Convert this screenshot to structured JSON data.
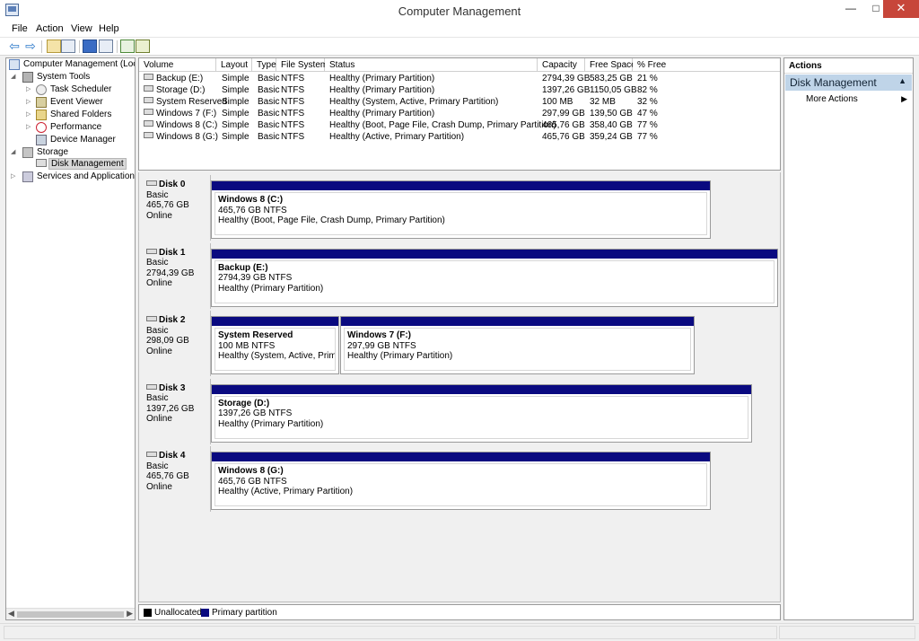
{
  "window": {
    "title": "Computer Management",
    "min": "—",
    "max": "□",
    "close": "✕"
  },
  "menu": [
    "File",
    "Action",
    "View",
    "Help"
  ],
  "toolbar": {
    "back": "⇦",
    "forward": "⇨"
  },
  "tree": {
    "root": "Computer Management (Local",
    "system_tools": "System Tools",
    "task_scheduler": "Task Scheduler",
    "event_viewer": "Event Viewer",
    "shared_folders": "Shared Folders",
    "performance": "Performance",
    "device_manager": "Device Manager",
    "storage": "Storage",
    "disk_management": "Disk Management",
    "services": "Services and Applications"
  },
  "volumes": {
    "headers": [
      "Volume",
      "Layout",
      "Type",
      "File System",
      "Status",
      "Capacity",
      "Free Space",
      "% Free"
    ],
    "rows": [
      [
        "Backup (E:)",
        "Simple",
        "Basic",
        "NTFS",
        "Healthy (Primary Partition)",
        "2794,39 GB",
        "583,25 GB",
        "21 %"
      ],
      [
        "Storage (D:)",
        "Simple",
        "Basic",
        "NTFS",
        "Healthy (Primary Partition)",
        "1397,26 GB",
        "1150,05 GB",
        "82 %"
      ],
      [
        "System Reserved",
        "Simple",
        "Basic",
        "NTFS",
        "Healthy (System, Active, Primary Partition)",
        "100 MB",
        "32 MB",
        "32 %"
      ],
      [
        "Windows 7 (F:)",
        "Simple",
        "Basic",
        "NTFS",
        "Healthy (Primary Partition)",
        "297,99 GB",
        "139,50 GB",
        "47 %"
      ],
      [
        "Windows 8 (C:)",
        "Simple",
        "Basic",
        "NTFS",
        "Healthy (Boot, Page File, Crash Dump, Primary Partition)",
        "465,76 GB",
        "358,40 GB",
        "77 %"
      ],
      [
        "Windows 8 (G:)",
        "Simple",
        "Basic",
        "NTFS",
        "Healthy (Active, Primary Partition)",
        "465,76 GB",
        "359,24 GB",
        "77 %"
      ]
    ]
  },
  "disks": [
    {
      "name": "Disk 0",
      "type": "Basic",
      "size": "465,76 GB",
      "state": "Online",
      "partitions": [
        {
          "name": "Windows 8  (C:)",
          "size": "465,76 GB NTFS",
          "status": "Healthy (Boot, Page File, Crash Dump, Primary Partition)"
        }
      ]
    },
    {
      "name": "Disk 1",
      "type": "Basic",
      "size": "2794,39 GB",
      "state": "Online",
      "partitions": [
        {
          "name": "Backup  (E:)",
          "size": "2794,39 GB NTFS",
          "status": "Healthy (Primary Partition)"
        }
      ]
    },
    {
      "name": "Disk 2",
      "type": "Basic",
      "size": "298,09 GB",
      "state": "Online",
      "partitions": [
        {
          "name": "System Reserved",
          "size": "100 MB NTFS",
          "status": "Healthy (System, Active, Primary"
        },
        {
          "name": "Windows 7  (F:)",
          "size": "297,99 GB NTFS",
          "status": "Healthy (Primary Partition)"
        }
      ]
    },
    {
      "name": "Disk 3",
      "type": "Basic",
      "size": "1397,26 GB",
      "state": "Online",
      "partitions": [
        {
          "name": "Storage  (D:)",
          "size": "1397,26 GB NTFS",
          "status": "Healthy (Primary Partition)"
        }
      ]
    },
    {
      "name": "Disk 4",
      "type": "Basic",
      "size": "465,76 GB",
      "state": "Online",
      "partitions": [
        {
          "name": "Windows 8  (G:)",
          "size": "465,76 GB NTFS",
          "status": "Healthy (Active, Primary Partition)"
        }
      ]
    }
  ],
  "legend": {
    "unallocated": "Unallocated",
    "primary": "Primary partition",
    "unallocated_color": "#000000",
    "primary_color": "#0a0a80"
  },
  "actions": {
    "header": "Actions",
    "section": "Disk Management",
    "more": "More Actions"
  }
}
